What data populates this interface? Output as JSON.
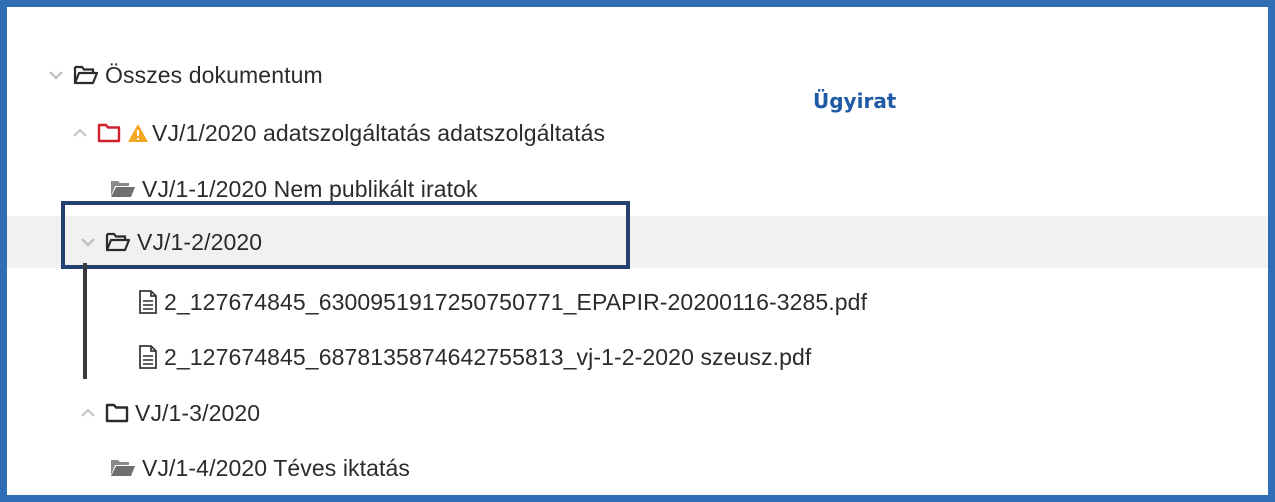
{
  "tree": {
    "root": {
      "label": "Összes dokumentum",
      "toggle": "chevron-down",
      "icon": "folder-open-outline"
    },
    "case": {
      "label": "VJ/1/2020 adatszolgáltatás adatszolgáltatás",
      "toggle": "chevron-up",
      "icon": "folder-red-outline",
      "warning": "warning-icon"
    },
    "items": [
      {
        "label": "VJ/1-1/2020 Nem publikált iratok",
        "icon": "folder-open-filled"
      },
      {
        "label": "VJ/1-2/2020",
        "toggle": "chevron-down",
        "icon": "folder-open-outline"
      },
      {
        "label": "2_127674845_6300951917250750771_EPAPIR-20200116-3285.pdf",
        "icon": "file-icon"
      },
      {
        "label": "2_127674845_6878135874642755813_vj-1-2-2020 szeusz.pdf",
        "icon": "file-icon"
      },
      {
        "label": "VJ/1-3/2020",
        "toggle": "chevron-up",
        "icon": "folder-outline"
      },
      {
        "label": "VJ/1-4/2020 Téves iktatás",
        "icon": "folder-open-filled"
      }
    ]
  },
  "annotation": {
    "ugyirat": "Ügyirat"
  },
  "colors": {
    "frame": "#2f6db5",
    "highlight": "#24406e",
    "accent": "#1f5aa6",
    "case_folder": "#d0202e",
    "warning": "#f5a623",
    "selected_row": "#f1f1f1"
  }
}
